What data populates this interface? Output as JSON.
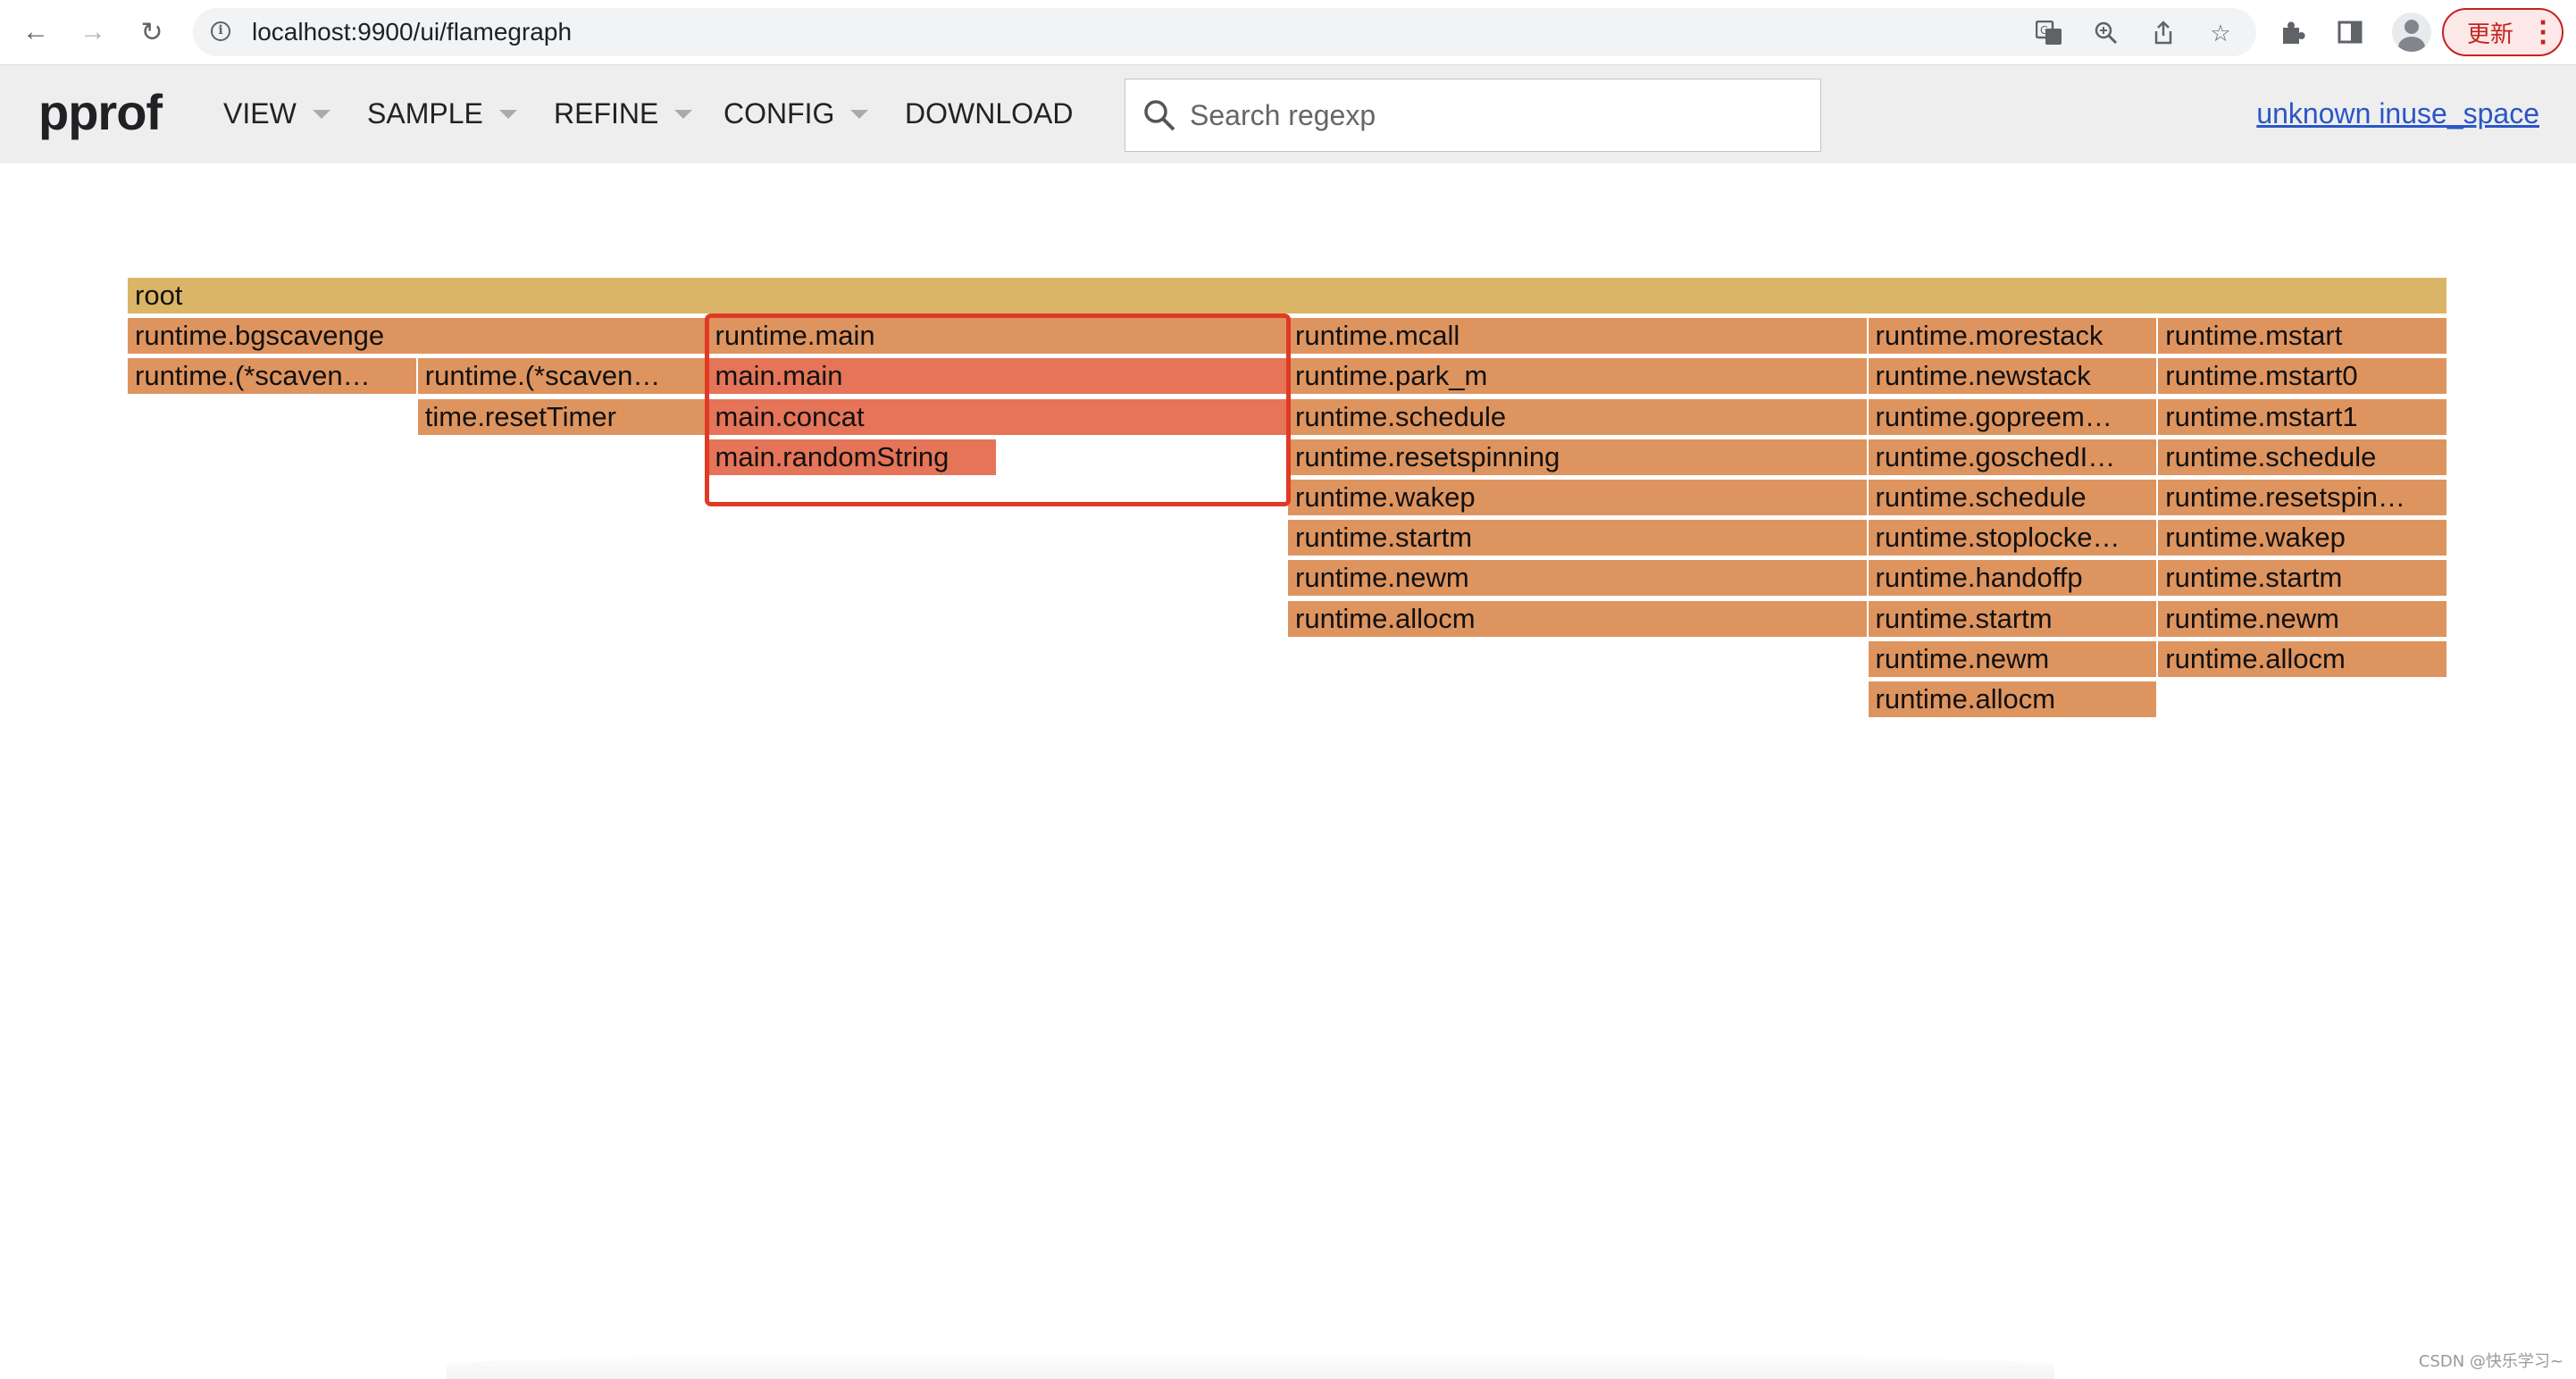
{
  "browser": {
    "url": "localhost:9900/ui/flamegraph",
    "update_label": "更新"
  },
  "header": {
    "logo": "pprof",
    "menus": [
      {
        "label": "VIEW",
        "has_caret": true
      },
      {
        "label": "SAMPLE",
        "has_caret": true
      },
      {
        "label": "REFINE",
        "has_caret": true
      },
      {
        "label": "CONFIG",
        "has_caret": true
      },
      {
        "label": "DOWNLOAD",
        "has_caret": false
      }
    ],
    "search_placeholder": "Search regexp",
    "search_value": "",
    "profile_link": "unknown inuse_space"
  },
  "flamegraph": {
    "root_color": "#dab567",
    "frame_color": "#de945f",
    "hot_color": "#e57458",
    "frames": [
      {
        "label": "root",
        "depth": 0,
        "start": 0,
        "span": 1,
        "color": "#dab567"
      },
      {
        "label": "runtime.bgscavenge",
        "depth": 1,
        "start": 0,
        "span": 0.25,
        "color": "#de945f"
      },
      {
        "label": "runtime.main",
        "depth": 1,
        "start": 0.25,
        "span": 0.25,
        "color": "#de945f"
      },
      {
        "label": "runtime.mcall",
        "depth": 1,
        "start": 0.5,
        "span": 0.25,
        "color": "#de945f"
      },
      {
        "label": "runtime.morestack",
        "depth": 1,
        "start": 0.75,
        "span": 0.125,
        "color": "#de945f"
      },
      {
        "label": "runtime.mstart",
        "depth": 1,
        "start": 0.875,
        "span": 0.125,
        "color": "#de945f"
      },
      {
        "label": "runtime.(*scaven…",
        "depth": 2,
        "start": 0,
        "span": 0.125,
        "color": "#de945f"
      },
      {
        "label": "runtime.(*scaven…",
        "depth": 2,
        "start": 0.125,
        "span": 0.125,
        "color": "#de945f"
      },
      {
        "label": "main.main",
        "depth": 2,
        "start": 0.25,
        "span": 0.25,
        "color": "#e57458"
      },
      {
        "label": "runtime.park_m",
        "depth": 2,
        "start": 0.5,
        "span": 0.25,
        "color": "#de945f"
      },
      {
        "label": "runtime.newstack",
        "depth": 2,
        "start": 0.75,
        "span": 0.125,
        "color": "#de945f"
      },
      {
        "label": "runtime.mstart0",
        "depth": 2,
        "start": 0.875,
        "span": 0.125,
        "color": "#de945f"
      },
      {
        "label": "time.resetTimer",
        "depth": 3,
        "start": 0.125,
        "span": 0.125,
        "color": "#de945f"
      },
      {
        "label": "main.concat",
        "depth": 3,
        "start": 0.25,
        "span": 0.25,
        "color": "#e57458"
      },
      {
        "label": "runtime.schedule",
        "depth": 3,
        "start": 0.5,
        "span": 0.25,
        "color": "#de945f"
      },
      {
        "label": "runtime.gopreem…",
        "depth": 3,
        "start": 0.75,
        "span": 0.125,
        "color": "#de945f"
      },
      {
        "label": "runtime.mstart1",
        "depth": 3,
        "start": 0.875,
        "span": 0.125,
        "color": "#de945f"
      },
      {
        "label": "main.randomString",
        "depth": 4,
        "start": 0.25,
        "span": 0.125,
        "color": "#e57458"
      },
      {
        "label": "runtime.resetspinning",
        "depth": 4,
        "start": 0.5,
        "span": 0.25,
        "color": "#de945f"
      },
      {
        "label": "runtime.goschedI…",
        "depth": 4,
        "start": 0.75,
        "span": 0.125,
        "color": "#de945f"
      },
      {
        "label": "runtime.schedule",
        "depth": 4,
        "start": 0.875,
        "span": 0.125,
        "color": "#de945f"
      },
      {
        "label": "runtime.wakep",
        "depth": 5,
        "start": 0.5,
        "span": 0.25,
        "color": "#de945f"
      },
      {
        "label": "runtime.schedule",
        "depth": 5,
        "start": 0.75,
        "span": 0.125,
        "color": "#de945f"
      },
      {
        "label": "runtime.resetspin…",
        "depth": 5,
        "start": 0.875,
        "span": 0.125,
        "color": "#de945f"
      },
      {
        "label": "runtime.startm",
        "depth": 6,
        "start": 0.5,
        "span": 0.25,
        "color": "#de945f"
      },
      {
        "label": "runtime.stoplocke…",
        "depth": 6,
        "start": 0.75,
        "span": 0.125,
        "color": "#de945f"
      },
      {
        "label": "runtime.wakep",
        "depth": 6,
        "start": 0.875,
        "span": 0.125,
        "color": "#de945f"
      },
      {
        "label": "runtime.newm",
        "depth": 7,
        "start": 0.5,
        "span": 0.25,
        "color": "#de945f"
      },
      {
        "label": "runtime.handoffp",
        "depth": 7,
        "start": 0.75,
        "span": 0.125,
        "color": "#de945f"
      },
      {
        "label": "runtime.startm",
        "depth": 7,
        "start": 0.875,
        "span": 0.125,
        "color": "#de945f"
      },
      {
        "label": "runtime.allocm",
        "depth": 8,
        "start": 0.5,
        "span": 0.25,
        "color": "#de945f"
      },
      {
        "label": "runtime.startm",
        "depth": 8,
        "start": 0.75,
        "span": 0.125,
        "color": "#de945f"
      },
      {
        "label": "runtime.newm",
        "depth": 8,
        "start": 0.875,
        "span": 0.125,
        "color": "#de945f"
      },
      {
        "label": "runtime.newm",
        "depth": 9,
        "start": 0.75,
        "span": 0.125,
        "color": "#de945f"
      },
      {
        "label": "runtime.allocm",
        "depth": 9,
        "start": 0.875,
        "span": 0.125,
        "color": "#de945f"
      },
      {
        "label": "runtime.allocm",
        "depth": 10,
        "start": 0.75,
        "span": 0.125,
        "color": "#de945f"
      }
    ]
  },
  "watermark": "CSDN @快乐学习~"
}
